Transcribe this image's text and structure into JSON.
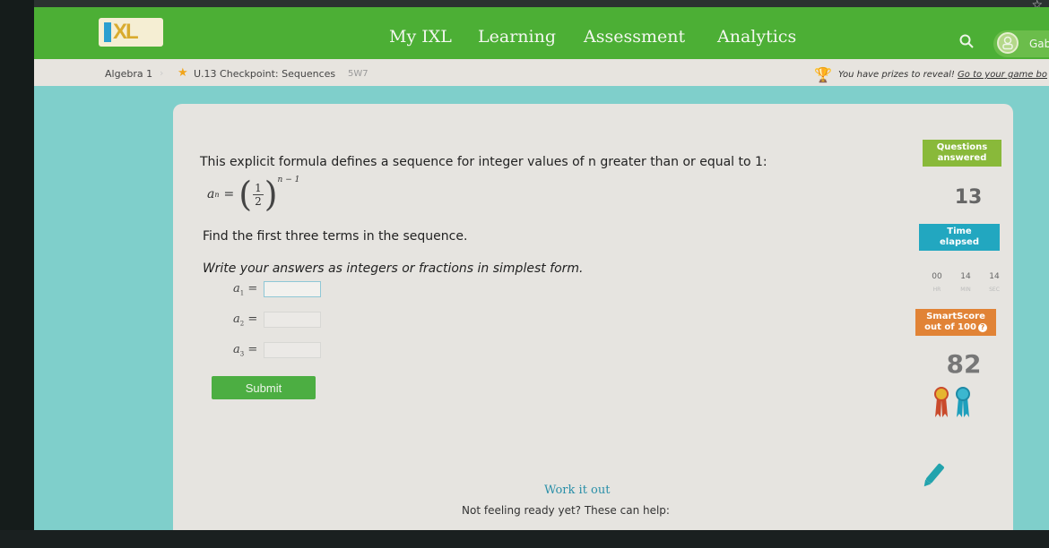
{
  "navbar": {
    "logo_text": "XL",
    "items": [
      {
        "label": "My IXL"
      },
      {
        "label": "Learning",
        "active": true
      },
      {
        "label": "Assessment"
      },
      {
        "label": "Analytics"
      }
    ],
    "user_name": "Gab"
  },
  "breadcrumb": {
    "subject": "Algebra 1",
    "separator": "›",
    "skill": "U.13 Checkpoint: Sequences",
    "skill_code": "5W7",
    "prize_text": "You have prizes to reveal! ",
    "prize_link": "Go to your game bo"
  },
  "question": {
    "intro": "This explicit formula defines a sequence for integer values of n greater than or equal to 1:",
    "formula": {
      "lhs": "a",
      "lhs_sub": "n",
      "eq": "=",
      "numerator": "1",
      "denominator": "2",
      "exponent": "n − 1"
    },
    "find": "Find the first three terms in the sequence.",
    "instruction": "Write your answers as integers or fractions in simplest form.",
    "answers": [
      {
        "label": "a",
        "sub": "1",
        "value": ""
      },
      {
        "label": "a",
        "sub": "2",
        "value": ""
      },
      {
        "label": "a",
        "sub": "3",
        "value": ""
      }
    ],
    "submit_label": "Submit"
  },
  "sidebar": {
    "questions_label_1": "Questions",
    "questions_label_2": "answered",
    "questions_answered": "13",
    "time_label_1": "Time",
    "time_label_2": "elapsed",
    "timer": [
      {
        "value": "00",
        "unit": "HR"
      },
      {
        "value": "14",
        "unit": "MIN"
      },
      {
        "value": "14",
        "unit": "SEC"
      }
    ],
    "smartscore_label_1": "SmartScore",
    "smartscore_label_2": "out of 100",
    "help_glyph": "?",
    "smartscore": "82"
  },
  "footer": {
    "work_it_out": "Work it out",
    "not_ready": "Not feeling ready yet? These can help:"
  },
  "colors": {
    "nav_green": "#4caf35",
    "questions_badge": "#89b93a",
    "time_badge": "#22a7c0",
    "smartscore_badge": "#e18336",
    "accent_teal": "#2a8fa8"
  }
}
